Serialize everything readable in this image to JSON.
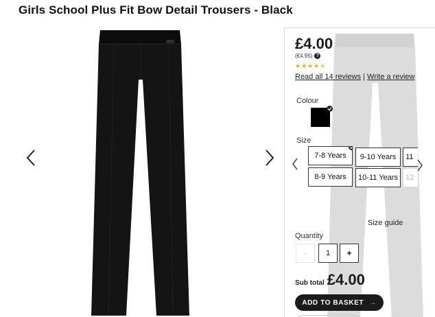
{
  "product": {
    "title": "Girls School Plus Fit Bow Detail Trousers - Black"
  },
  "gallery": {
    "prev_icon": "chevron-left-icon",
    "next_icon": "chevron-right-icon"
  },
  "pricing": {
    "price": "£4.00",
    "price_alt": "(€4.95)",
    "rating_stars": 4.5,
    "rating_max": 5,
    "reviews_link": "Read all 14 reviews",
    "separator": "|",
    "write_review_link": "Write a review"
  },
  "colour": {
    "label": "Colour",
    "selected": "Black",
    "swatch_color": "#000000"
  },
  "size": {
    "label": "Size",
    "options_row1": [
      "7-8 Years",
      "9-10 Years",
      "11"
    ],
    "options_row2": [
      "8-9 Years",
      "10-11 Years",
      "12"
    ],
    "selected": "7-8 Years",
    "guide_label": "Size guide"
  },
  "quantity": {
    "label": "Quantity",
    "minus": "-",
    "value": "1",
    "plus": "+"
  },
  "subtotal": {
    "label": "Sub total",
    "value": "£4.00"
  },
  "actions": {
    "add_to_basket": "ADD TO BASKET",
    "add_arrow": "→"
  },
  "colors": {
    "accent": "#f0b400",
    "button_bg": "#1b1b1b"
  }
}
